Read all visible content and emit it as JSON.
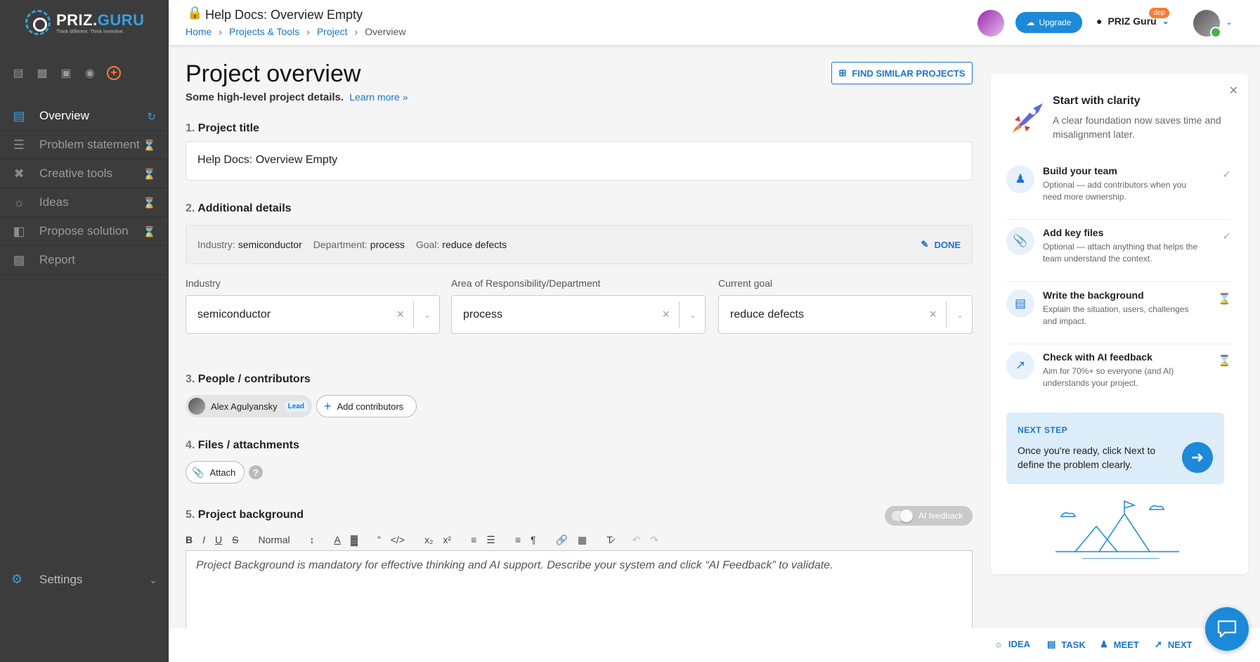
{
  "brand": {
    "name_a": "PRIZ.",
    "name_b": "GURU",
    "tagline": "Think different. Think inventive."
  },
  "sidebar": {
    "items": [
      {
        "label": "Overview",
        "icon": "document-icon",
        "status": "in-progress",
        "active": true
      },
      {
        "label": "Problem statement",
        "icon": "layers-icon",
        "status": "hourglass"
      },
      {
        "label": "Creative tools",
        "icon": "tools-icon",
        "status": "hourglass"
      },
      {
        "label": "Ideas",
        "icon": "lightbulb-icon",
        "status": "hourglass"
      },
      {
        "label": "Propose solution",
        "icon": "presentation-icon",
        "status": "hourglass"
      },
      {
        "label": "Report",
        "icon": "report-icon"
      }
    ],
    "settings_label": "Settings"
  },
  "header": {
    "title": "Help Docs: Overview Empty",
    "breadcrumbs": [
      "Home",
      "Projects & Tools",
      "Project",
      "Overview"
    ],
    "upgrade_label": "Upgrade",
    "user_name": "PRIZ Guru",
    "badge": "dep"
  },
  "main": {
    "heading": "Project overview",
    "subtitle": "Some high-level project details.",
    "learn_more": "Learn more »",
    "find_similar": "FIND SIMILAR PROJECTS",
    "sections": {
      "s1": {
        "num": "1.",
        "label": "Project title"
      },
      "s2": {
        "num": "2.",
        "label": "Additional details"
      },
      "s3": {
        "num": "3.",
        "label": "People / contributors"
      },
      "s4": {
        "num": "4.",
        "label": "Files / attachments"
      },
      "s5": {
        "num": "5.",
        "label": "Project background"
      }
    },
    "project_title_value": "Help Docs: Overview Empty",
    "summary": {
      "industry_key": "Industry:",
      "industry_val": "semiconductor",
      "dept_key": "Department:",
      "dept_val": "process",
      "goal_key": "Goal:",
      "goal_val": "reduce defects",
      "done_label": "DONE"
    },
    "fields": {
      "industry": {
        "label": "Industry",
        "value": "semiconductor"
      },
      "department": {
        "label": "Area of Responsibility/Department",
        "value": "process"
      },
      "goal": {
        "label": "Current goal",
        "value": "reduce defects"
      }
    },
    "contributors": {
      "name": "Alex Agulyansky",
      "role": "Lead",
      "add_label": "Add contributors"
    },
    "attach_label": "Attach",
    "ai_feedback_label": "AI feedback",
    "editor": {
      "format_value": "Normal",
      "placeholder": "Project Background is mandatory for effective thinking and AI support. Describe your system and click “AI Feedback” to validate."
    }
  },
  "panel": {
    "title": "Start with clarity",
    "desc": "A clear foundation now saves time and misalignment later.",
    "steps": [
      {
        "title": "Build your team",
        "desc": "Optional — add contributors when you need more ownership.",
        "icon": "people-icon",
        "status": "check"
      },
      {
        "title": "Add key files",
        "desc": "Optional — attach anything that helps the team understand the context.",
        "icon": "paperclip-icon",
        "status": "check"
      },
      {
        "title": "Write the background",
        "desc": "Explain the situation, users, challenges and impact.",
        "icon": "document-icon",
        "status": "hourglass"
      },
      {
        "title": "Check with AI feedback",
        "desc": "Aim for 70%+ so everyone (and AI) understands your project.",
        "icon": "sparkle-chart-icon",
        "status": "hourglass"
      }
    ],
    "next_step_label": "NEXT STEP",
    "next_step_text": "Once you're ready, click Next to define the problem clearly."
  },
  "bottombar": {
    "idea": "IDEA",
    "task": "TASK",
    "meet": "MEET",
    "next": "NEXT"
  },
  "colors": {
    "accent": "#1c8ad8",
    "link": "#1976d2",
    "sidebar": "#3c3c3c",
    "badge": "#ff7a2f"
  }
}
